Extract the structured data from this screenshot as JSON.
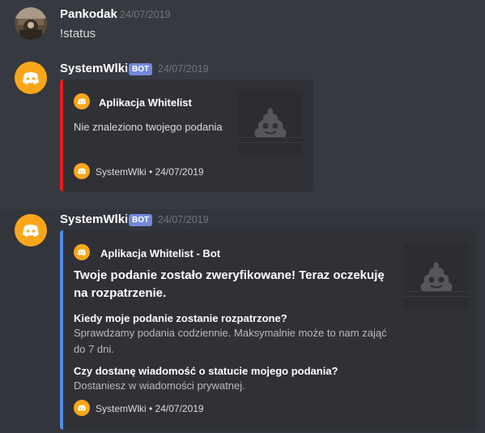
{
  "messages": [
    {
      "username": "Pankodak",
      "timestamp": "24/07/2019",
      "text": "!status",
      "avatar_icon": "user-photo-avatar"
    },
    {
      "username": "SystemWlki",
      "badge": "BOT",
      "timestamp": "24/07/2019",
      "avatar_icon": "discord-logo-icon",
      "embed": {
        "accent_color": "#e91e1e",
        "author": "Aplikacja Whitelist",
        "description": "Nie znaleziono twojego podania",
        "thumbnail_icon": "poop-icon",
        "footer": "SystemWlki • 24/07/2019"
      }
    },
    {
      "username": "SystemWlki",
      "badge": "BOT",
      "timestamp": "24/07/2019",
      "avatar_icon": "discord-logo-icon",
      "embed": {
        "accent_color": "#4f8ee6",
        "author": "Aplikacja Whitelist - Bot",
        "title": "Twoje podanie zostało zweryfikowane! Teraz oczekuję na rozpatrzenie.",
        "thumbnail_icon": "poop-icon",
        "fields": [
          {
            "name": "Kiedy moje podanie zostanie rozpatrzone?",
            "value": "Sprawdzamy podania codziennie. Maksymalnie może to nam zająć do 7 dni."
          },
          {
            "name": "Czy dostanę wiadomość o statucie mojego podania?",
            "value": "Dostaniesz w wiadomości prywatnej."
          }
        ],
        "footer": "SystemWlki • 24/07/2019"
      }
    }
  ],
  "colors": {
    "background": "#36393f",
    "embed_background": "#2f3136",
    "bot_badge": "#7289da",
    "bot_avatar": "#faa61a"
  }
}
